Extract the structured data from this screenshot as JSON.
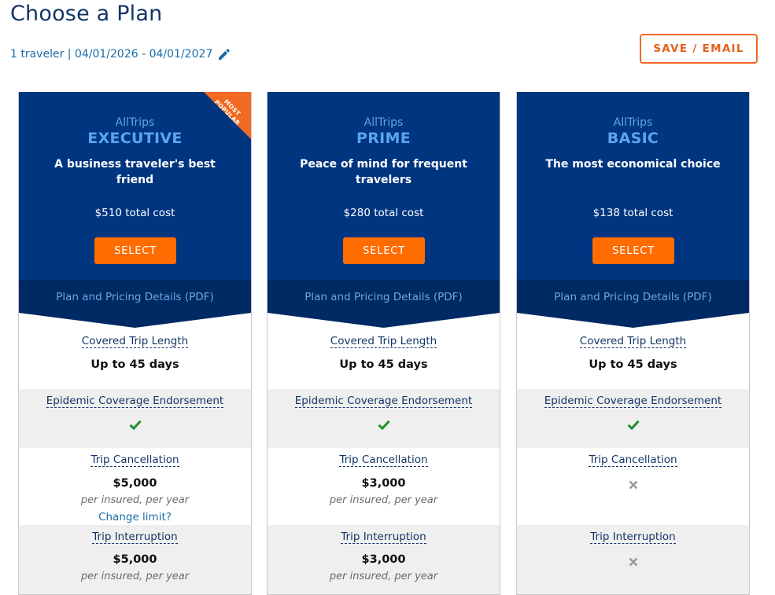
{
  "page": {
    "title": "Choose a Plan",
    "trip_summary": "1 traveler | 04/01/2026 - 04/01/2027",
    "edit_icon": "pencil-icon",
    "save_email_label": "SAVE / EMAIL"
  },
  "colors": {
    "header_blue": "#003580",
    "pdf_band_blue": "#002a63",
    "accent_orange": "#ff6c00",
    "check_green": "#1e8f2e",
    "x_gray": "#9a9a9a"
  },
  "plans": [
    {
      "brand": "AllTrips",
      "name": "EXECUTIVE",
      "tagline": "A business traveler's best friend",
      "price": "$510 total cost",
      "select_label": "SELECT",
      "pdf_label": "Plan and Pricing Details (PDF)",
      "badge": "MOST POPULAR",
      "badge_line1": "MOST",
      "badge_line2": "POPULAR",
      "features": {
        "trip_length_label": "Covered Trip Length",
        "trip_length_value": "Up to 45 days",
        "epidemic_label": "Epidemic Coverage Endorsement",
        "epidemic_included": true,
        "cancellation_label": "Trip Cancellation",
        "cancellation_value": "$5,000",
        "cancellation_note": "per insured, per year",
        "change_limit_label": "Change limit?",
        "interruption_label": "Trip Interruption",
        "interruption_value": "$5,000",
        "interruption_note": "per insured, per year"
      }
    },
    {
      "brand": "AllTrips",
      "name": "PRIME",
      "tagline": "Peace of mind for frequent travelers",
      "price": "$280 total cost",
      "select_label": "SELECT",
      "pdf_label": "Plan and Pricing Details (PDF)",
      "features": {
        "trip_length_label": "Covered Trip Length",
        "trip_length_value": "Up to 45 days",
        "epidemic_label": "Epidemic Coverage Endorsement",
        "epidemic_included": true,
        "cancellation_label": "Trip Cancellation",
        "cancellation_value": "$3,000",
        "cancellation_note": "per insured, per year",
        "interruption_label": "Trip Interruption",
        "interruption_value": "$3,000",
        "interruption_note": "per insured, per year"
      }
    },
    {
      "brand": "AllTrips",
      "name": "BASIC",
      "tagline": "The most economical choice",
      "price": "$138 total cost",
      "select_label": "SELECT",
      "pdf_label": "Plan and Pricing Details (PDF)",
      "features": {
        "trip_length_label": "Covered Trip Length",
        "trip_length_value": "Up to 45 days",
        "epidemic_label": "Epidemic Coverage Endorsement",
        "epidemic_included": true,
        "cancellation_label": "Trip Cancellation",
        "cancellation_included": false,
        "interruption_label": "Trip Interruption",
        "interruption_included": false
      }
    }
  ]
}
